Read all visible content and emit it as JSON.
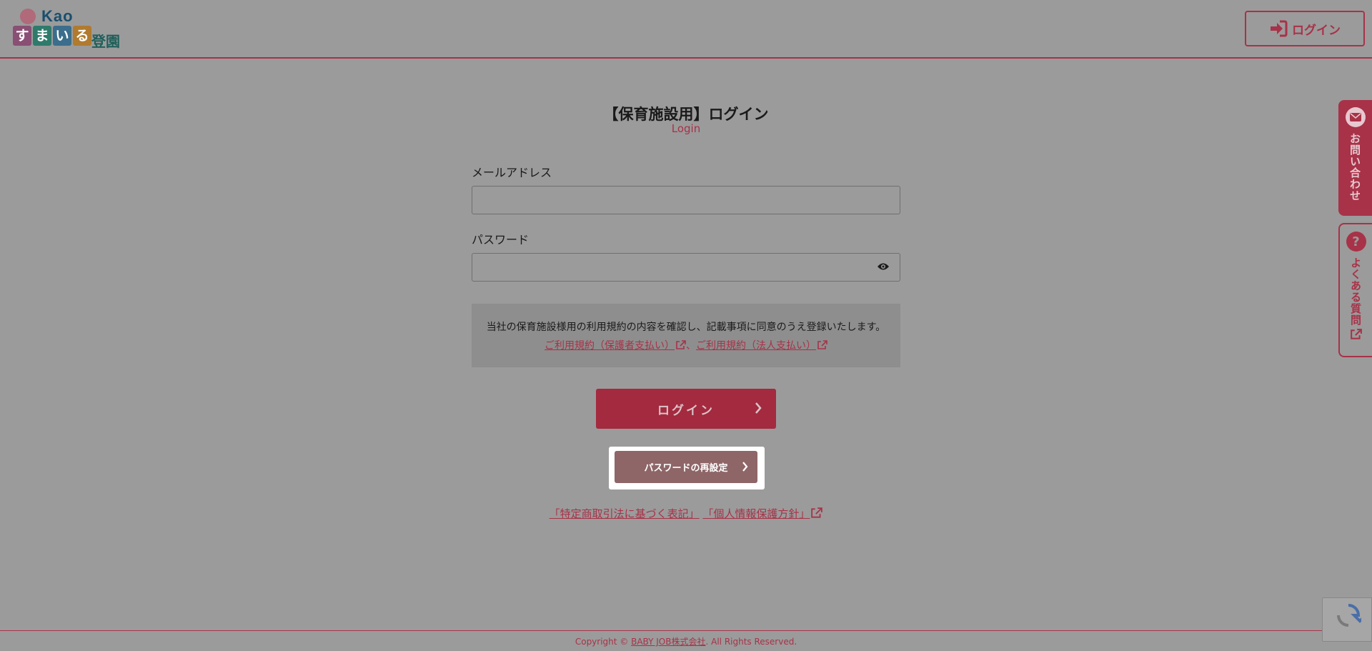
{
  "header": {
    "logo_brand": "Kao",
    "logo_blocks": [
      "す",
      "ま",
      "い",
      "る"
    ],
    "logo_suffix": "登園",
    "login_button_label": "ログイン"
  },
  "main": {
    "title": "【保育施設用】ログイン",
    "subtitle": "Login",
    "email_label": "メールアドレス",
    "email_value": "",
    "password_label": "パスワード",
    "password_value": "",
    "terms_text": "当社の保育施設様用の利用規約の内容を確認し、記載事項に同意のうえ登録いたします。",
    "terms_link_1": "ご利用規約（保護者支払い）",
    "terms_separator": "、",
    "terms_link_2": "ご利用規約（法人支払い）",
    "login_button_label": "ログイン",
    "reset_button_label": "パスワードの再設定",
    "legal_link_1": "「特定商取引法に基づく表記」",
    "legal_link_2": "「個人情報保護方針」"
  },
  "side_tabs": {
    "contact_label": "お問い合わせ",
    "faq_label": "よくある質問",
    "faq_icon_glyph": "?"
  },
  "footer": {
    "copyright_prefix": "Copyright © ",
    "company": "BABY JOB株式会社",
    "copyright_suffix": ". All Rights Reserved."
  },
  "colors": {
    "accent": "#a83248",
    "overlay_background": "#9b9b9b",
    "login_button": "#a32a3f",
    "reset_button": "#8e6668"
  }
}
